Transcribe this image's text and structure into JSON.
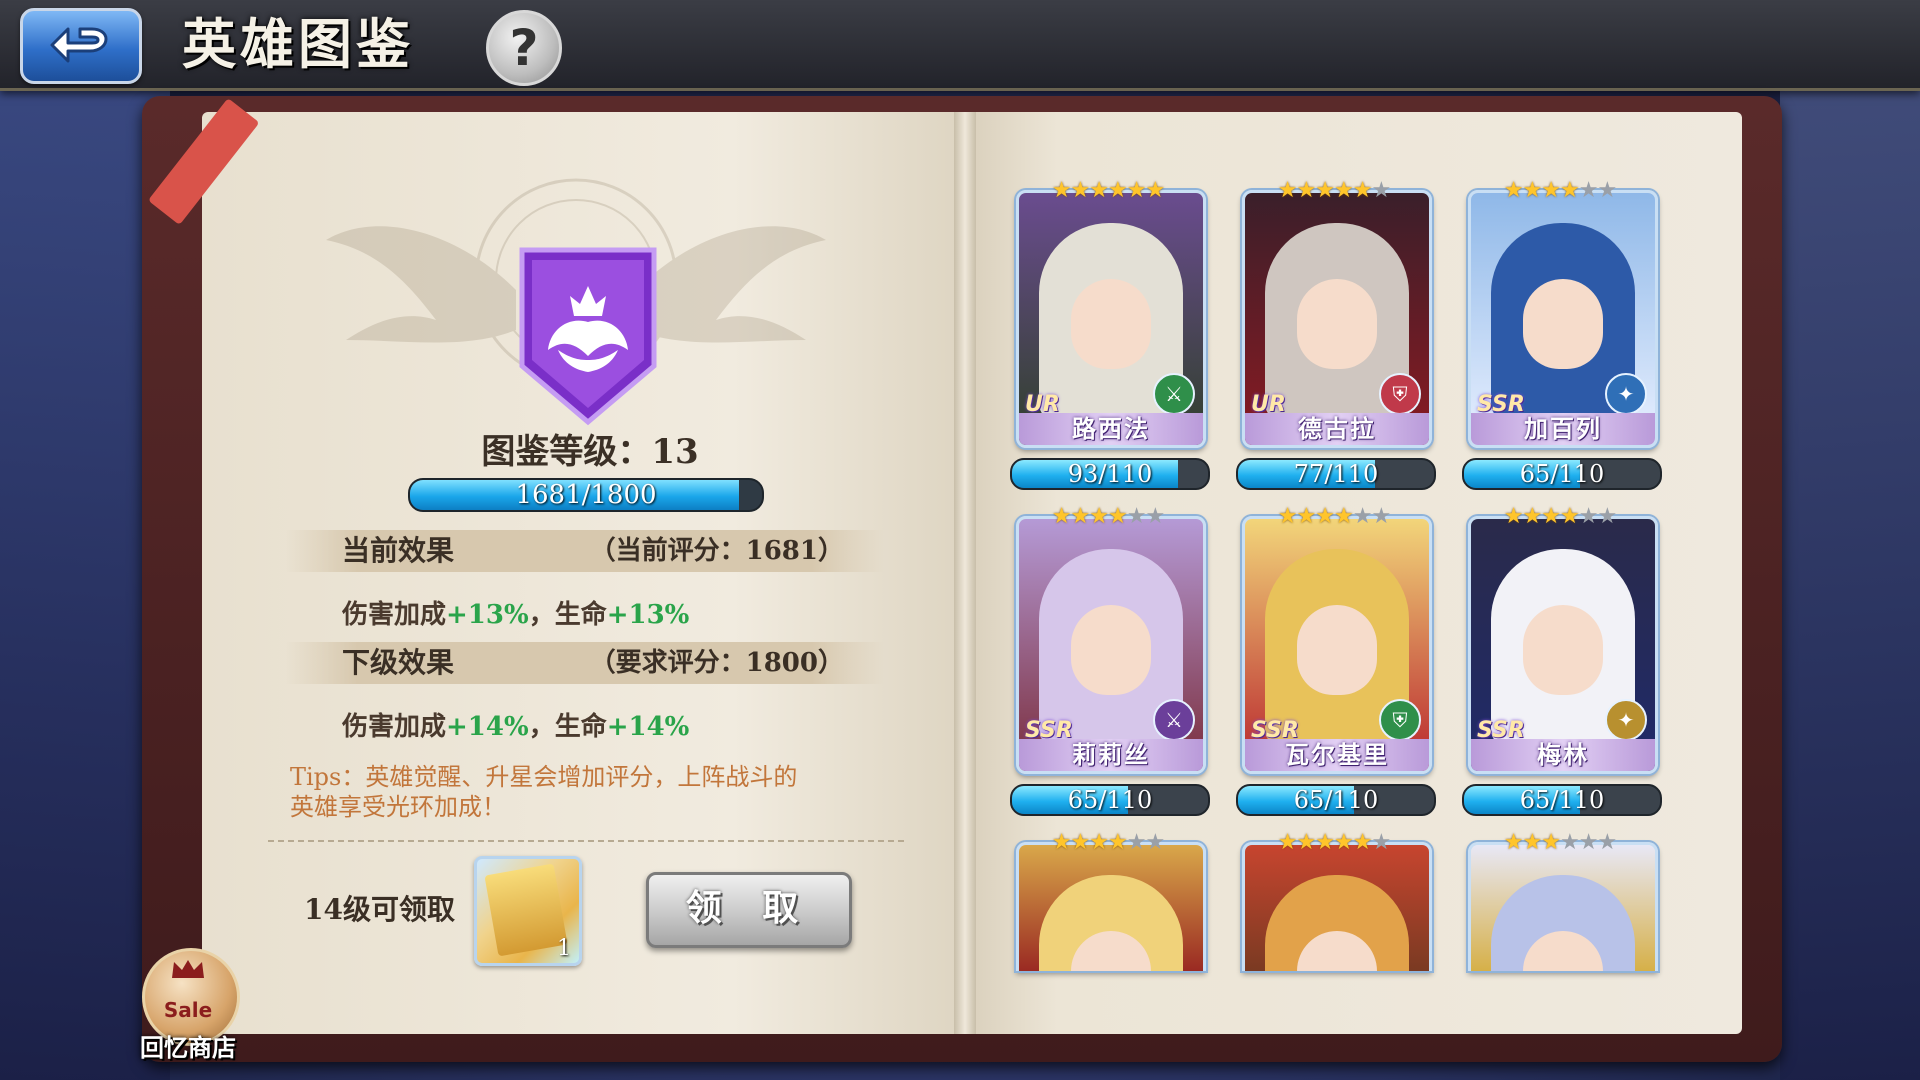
{
  "header": {
    "title": "英雄图鉴",
    "back_icon": "back-arrow-icon",
    "help_label": "?"
  },
  "codex": {
    "level_label": "图鉴等级：13",
    "progress": {
      "current": 1681,
      "max": 1800,
      "text": "1681/1800"
    },
    "current_effect": {
      "label": "当前效果",
      "score_text": "（当前评分：1681）",
      "damage_label": "伤害加成",
      "damage_value": "+13%",
      "sep": "，",
      "hp_label": "生命",
      "hp_value": "+13%"
    },
    "next_effect": {
      "label": "下级效果",
      "score_text": "（要求评分：1800）",
      "damage_label": "伤害加成",
      "damage_value": "+14%",
      "sep": "，",
      "hp_label": "生命",
      "hp_value": "+14%"
    },
    "tips_line1": "Tips：英雄觉醒、升星会增加评分，上阵战斗的",
    "tips_line2": "英雄享受光环加成！",
    "reward_label": "14级可领取",
    "reward_count": "1",
    "claim_button": "领 取"
  },
  "shop": {
    "sale_text": "Sale",
    "label": "回忆商店"
  },
  "heroes": [
    {
      "name": "路西法",
      "rarity": "UR",
      "stars": 6,
      "max_stars": 6,
      "frag_current": 93,
      "frag_max": 110,
      "frag_text": "93/110",
      "role_icon": "sword-icon",
      "role_color": "#2f8f4a",
      "palette": [
        "#6a4c8f",
        "#e3e0d6",
        "#2f3f2a"
      ]
    },
    {
      "name": "德古拉",
      "rarity": "UR",
      "stars": 5,
      "max_stars": 6,
      "frag_current": 77,
      "frag_max": 110,
      "frag_text": "77/110",
      "role_icon": "shield-icon",
      "role_color": "#c0394a",
      "palette": [
        "#3a1f2a",
        "#cfc6c0",
        "#8b1a22"
      ]
    },
    {
      "name": "加百列",
      "rarity": "SSR",
      "stars": 4,
      "max_stars": 6,
      "frag_current": 65,
      "frag_max": 110,
      "frag_text": "65/110",
      "role_icon": "staff-icon",
      "role_color": "#2f6fb7",
      "palette": [
        "#8fb8e8",
        "#2d5aa8",
        "#e8f0ff"
      ]
    },
    {
      "name": "莉莉丝",
      "rarity": "SSR",
      "stars": 4,
      "max_stars": 6,
      "frag_current": 65,
      "frag_max": 110,
      "frag_text": "65/110",
      "role_icon": "sword-icon",
      "role_color": "#6b3f9a",
      "palette": [
        "#b59ad6",
        "#d6c6ea",
        "#7a2c3a"
      ]
    },
    {
      "name": "瓦尔基里",
      "rarity": "SSR",
      "stars": 4,
      "max_stars": 6,
      "frag_current": 65,
      "frag_max": 110,
      "frag_text": "65/110",
      "role_icon": "shield-icon",
      "role_color": "#2f8f4a",
      "palette": [
        "#f2d57a",
        "#e8c25a",
        "#b8242c"
      ]
    },
    {
      "name": "梅林",
      "rarity": "SSR",
      "stars": 4,
      "max_stars": 6,
      "frag_current": 65,
      "frag_max": 110,
      "frag_text": "65/110",
      "role_icon": "staff-icon",
      "role_color": "#b8902f",
      "palette": [
        "#2a2a4a",
        "#f2f2f7",
        "#1f2a6a"
      ]
    },
    {
      "name": "",
      "rarity": "",
      "stars": 4,
      "max_stars": 6,
      "partial": true,
      "palette": [
        "#d9a84a",
        "#f0d27a",
        "#9a2a22"
      ]
    },
    {
      "name": "",
      "rarity": "",
      "stars": 5,
      "max_stars": 6,
      "partial": true,
      "palette": [
        "#c7452f",
        "#e2a24a",
        "#7a3a22"
      ]
    },
    {
      "name": "",
      "rarity": "",
      "stars": 3,
      "max_stars": 6,
      "partial": true,
      "palette": [
        "#e8e8f6",
        "#b8c2e8",
        "#d6b048"
      ]
    }
  ],
  "colors": {
    "accent_blue": "#1aa6ea",
    "bonus_green": "#2aa44a",
    "tips_orange": "#c2763b",
    "book_red": "#5a2a2a"
  }
}
